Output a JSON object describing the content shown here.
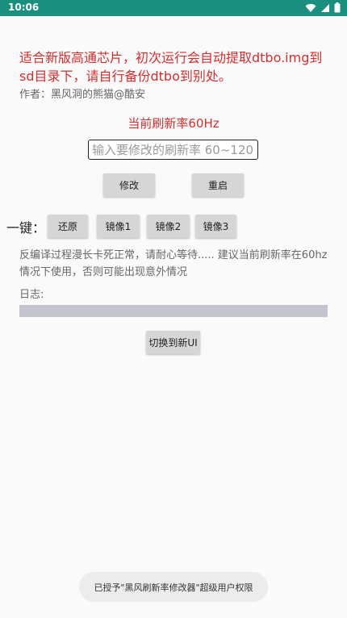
{
  "statusbar": {
    "time": "10:06",
    "icons": [
      "wifi-icon",
      "signal-icon",
      "battery-icon"
    ],
    "color": "#1a8f7e"
  },
  "notice": "适合新版高通芯片，初次运行会自动提取dtbo.img到sd目录下，请自行备份dtbo到别处。",
  "author": "作者：黑风洞的熊猫@酷安",
  "current_rate": "当前刷新率60Hz",
  "rate_input": {
    "placeholder": "输入要修改的刷新率 60~120",
    "value": ""
  },
  "buttons": {
    "modify": "修改",
    "reboot": "重启",
    "restore": "还原",
    "mirror1": "镜像1",
    "mirror2": "镜像2",
    "mirror3": "镜像3",
    "switch_ui": "切换到新UI"
  },
  "onekey_label": "一键：",
  "hint": "反编译过程漫长卡死正常，请耐心等待..... 建议当前刷新率在60hz情况下使用，否则可能出现意外情况",
  "log_label": "日志:",
  "toast": "已授予\"黑风刷新率修改器\"超级用户权限",
  "colors": {
    "accent_red": "#d32f2f",
    "button_bg": "#d6d6d6"
  }
}
